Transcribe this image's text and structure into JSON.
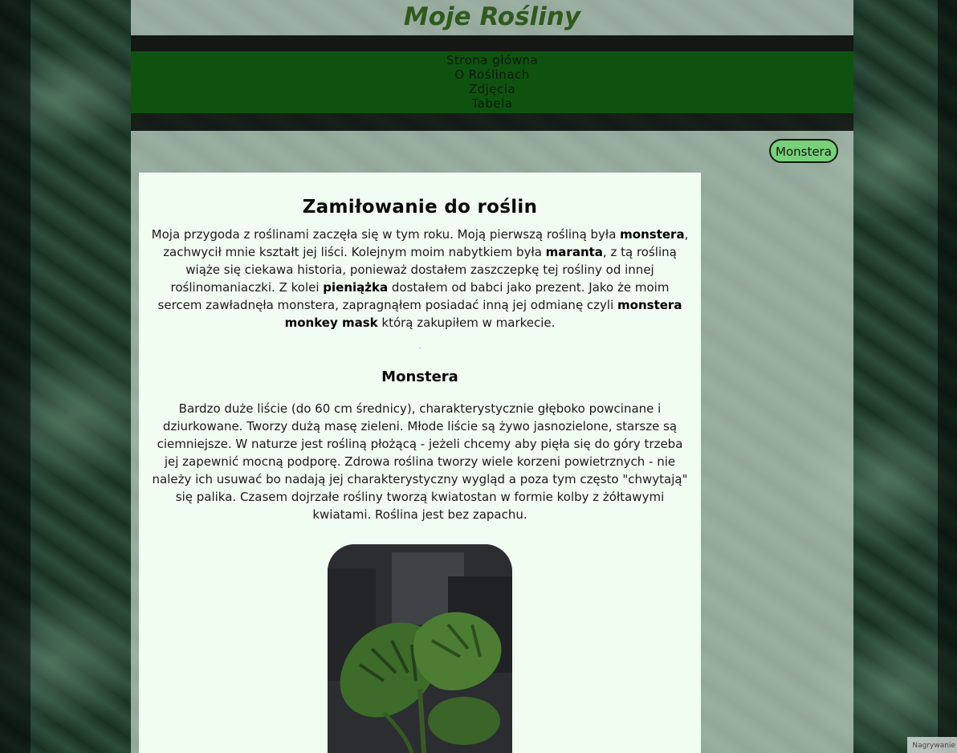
{
  "header": {
    "title": "Moje Rośliny"
  },
  "nav": {
    "items": [
      {
        "label": "Strona główna"
      },
      {
        "label": "O Roślinach"
      },
      {
        "label": "Zdjęcia"
      },
      {
        "label": "Tabela"
      }
    ]
  },
  "tag_button": {
    "label": "Monstera"
  },
  "article": {
    "heading": "Zamiłowanie do roślin",
    "intro": {
      "t1": "Moja przygoda z roślinami zaczęła się w tym roku. Moją pierwszą rośliną była ",
      "b1": "monstera",
      "t2": ", zachwycił mnie kształt jej liści. Kolejnym moim nabytkiem była ",
      "b2": "maranta",
      "t3": ", z tą rośliną wiąże się ciekawa historia, ponieważ dostałem zaszczepkę tej rośliny od innej roślinomaniaczki. Z kolei ",
      "b3": "pieniążka",
      "t4": " dostałem od babci jako prezent. Jako że moim sercem zawładnęła monstera, zapragnąłem posiadać inną jej odmianę czyli ",
      "b4": "monstera monkey mask",
      "t5": " którą zakupiłem w markecie."
    },
    "separator": ".",
    "section_heading": "Monstera",
    "section_text": "Bardzo duże liście (do 60 cm średnicy), charakterystycznie głęboko powcinane i dziurkowane. Tworzy dużą masę zieleni. Młode liście są żywo jasnozielone, starsze są ciemniejsze. W naturze jest rośliną płożącą - jeżeli chcemy aby pięła się do góry trzeba jej zapewnić mocną podporę. Zdrowa roślina tworzy wiele korzeni powietrznych - nie należy ich usuwać bo nadają jej charakterystyczny wygląd a poza tym często \"chwytają\" się palika. Czasem dojrzałe rośliny tworzą kwiatostan w formie kolby z żółtawymi kwiatami. Roślina jest bez zapachu."
  },
  "corner": {
    "label": "Nagrywanie"
  },
  "colors": {
    "title": "#2f5a1e",
    "nav_bg": "#0f5210",
    "button_bg": "#78d07a",
    "article_bg": "#f0fdf0"
  }
}
